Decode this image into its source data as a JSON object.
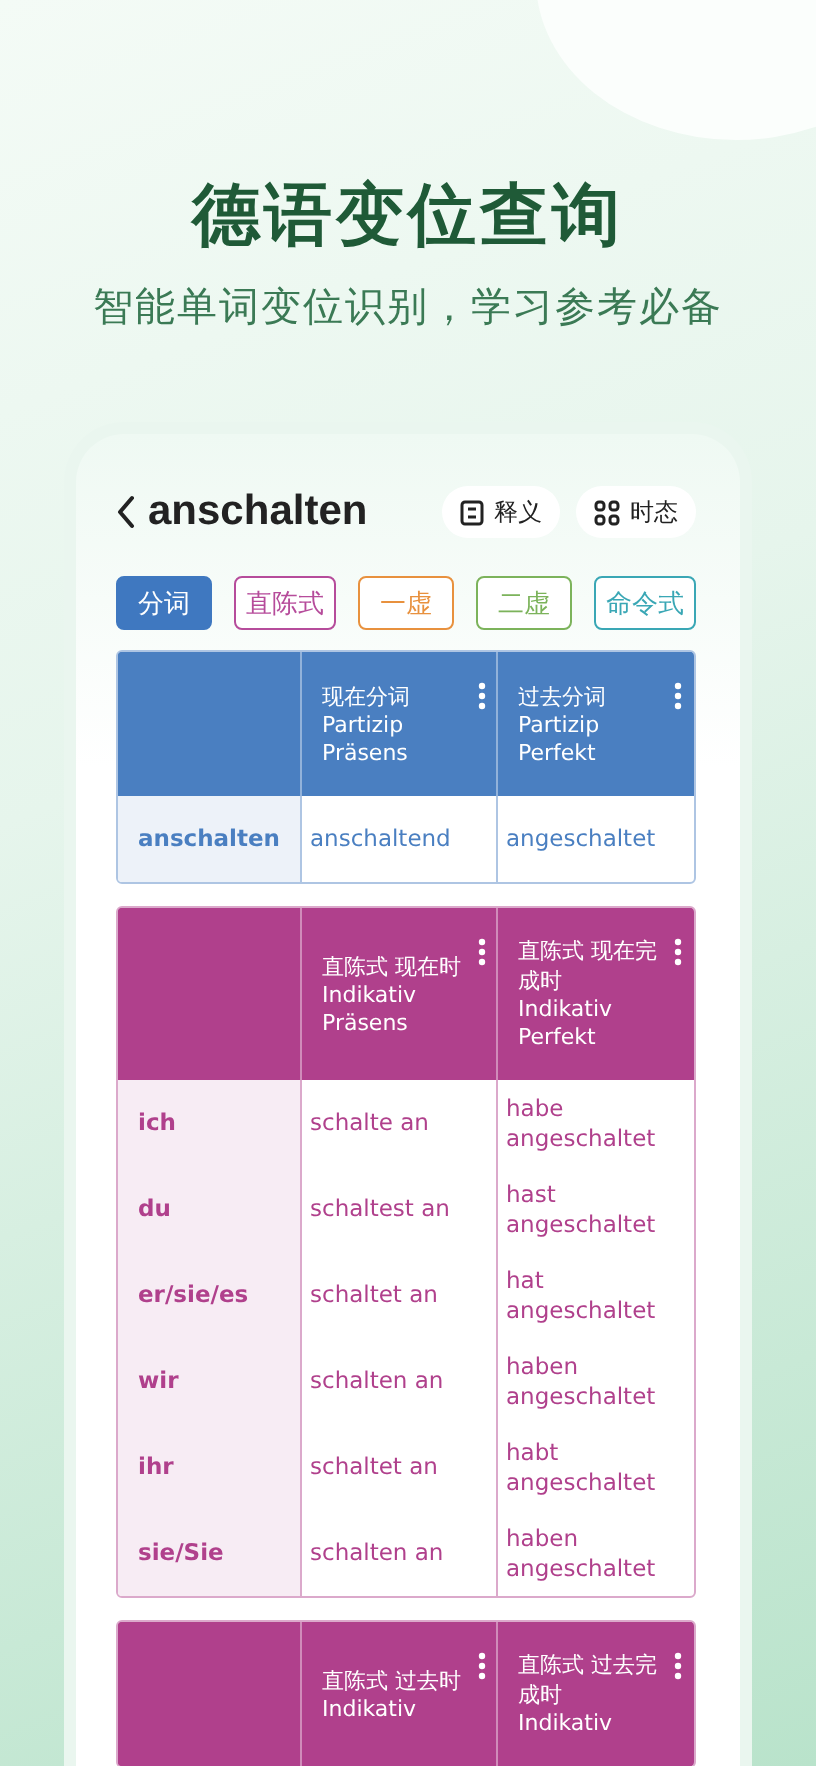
{
  "headline": "德语变位查询",
  "tagline": "智能单词变位识别，学习参考必备",
  "word": "anschalten",
  "header_buttons": [
    {
      "label": "释义",
      "kind": "doc"
    },
    {
      "label": "时态",
      "kind": "grid"
    }
  ],
  "mode_tabs": [
    {
      "label": "分词",
      "selected": true,
      "color": "#3f78c0"
    },
    {
      "label": "直陈式",
      "selected": false,
      "color": "#b64c9b"
    },
    {
      "label": "一虚",
      "selected": false,
      "color": "#e8913e"
    },
    {
      "label": "二虚",
      "selected": false,
      "color": "#7cb35b"
    },
    {
      "label": "命令式",
      "selected": false,
      "color": "#3aa7b5"
    }
  ],
  "tables": [
    {
      "color": "#4a7fc1",
      "columns": [
        {
          "title": "现在分词",
          "subtitle": "Partizip Präsens"
        },
        {
          "title": "过去分词",
          "subtitle": "Partizip Perfekt"
        }
      ],
      "rows": [
        {
          "label": "anschalten",
          "cells": [
            "anschaltend",
            "angeschaltet"
          ]
        }
      ]
    },
    {
      "color": "#b0408c",
      "columns": [
        {
          "title": "直陈式 现在时",
          "subtitle": "Indikativ Präsens"
        },
        {
          "title": "直陈式 现在完成时",
          "subtitle": "Indikativ Perfekt"
        }
      ],
      "rows": [
        {
          "label": "ich",
          "cells": [
            "schalte an",
            "habe angeschaltet"
          ]
        },
        {
          "label": "du",
          "cells": [
            "schaltest an",
            "hast angeschaltet"
          ]
        },
        {
          "label": "er/sie/es",
          "cells": [
            "schaltet an",
            "hat angeschaltet"
          ]
        },
        {
          "label": "wir",
          "cells": [
            "schalten an",
            "haben angeschaltet"
          ]
        },
        {
          "label": "ihr",
          "cells": [
            "schaltet an",
            "habt angeschaltet"
          ]
        },
        {
          "label": "sie/Sie",
          "cells": [
            "schalten an",
            "haben angeschaltet"
          ]
        }
      ]
    },
    {
      "color": "#b0408c",
      "columns": [
        {
          "title": "直陈式 过去时",
          "subtitle": "Indikativ"
        },
        {
          "title": "直陈式 过去完成时",
          "subtitle": "Indikativ"
        }
      ]
    }
  ]
}
